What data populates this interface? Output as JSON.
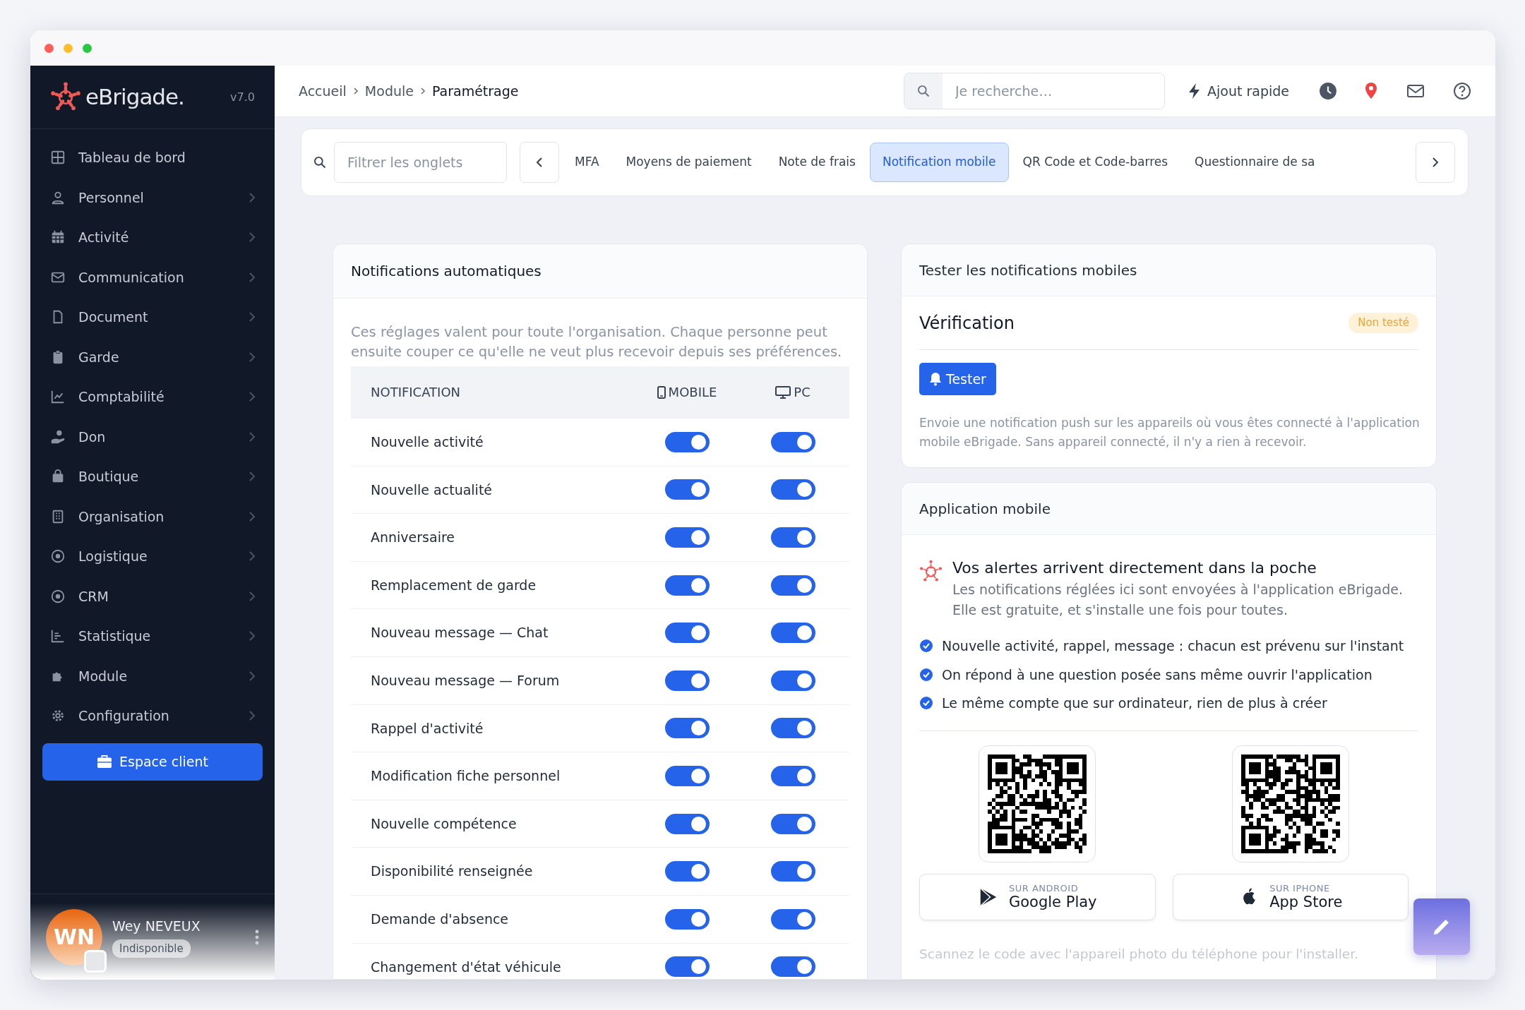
{
  "sidebar": {
    "logo": "eBrigade.",
    "version": "v7.0",
    "items": [
      {
        "label": "Tableau de bord",
        "expandable": false
      },
      {
        "label": "Personnel",
        "expandable": true
      },
      {
        "label": "Activité",
        "expandable": true
      },
      {
        "label": "Communication",
        "expandable": true
      },
      {
        "label": "Document",
        "expandable": true
      },
      {
        "label": "Garde",
        "expandable": true
      },
      {
        "label": "Comptabilité",
        "expandable": true
      },
      {
        "label": "Don",
        "expandable": true
      },
      {
        "label": "Boutique",
        "expandable": true
      },
      {
        "label": "Organisation",
        "expandable": true
      },
      {
        "label": "Logistique",
        "expandable": true
      },
      {
        "label": "CRM",
        "expandable": true
      },
      {
        "label": "Statistique",
        "expandable": true
      },
      {
        "label": "Module",
        "expandable": true
      },
      {
        "label": "Configuration",
        "expandable": true
      }
    ],
    "cta": "Espace client",
    "user": {
      "initials": "WN",
      "name": "Wey NEVEUX",
      "status": "Indisponible"
    }
  },
  "breadcrumb": [
    "Accueil",
    "Module",
    "Paramétrage"
  ],
  "search": {
    "placeholder": "Je recherche…"
  },
  "quick_add": "Ajout rapide",
  "tab_filter": {
    "placeholder": "Filtrer les onglets"
  },
  "tabs": [
    {
      "label": "MFA",
      "selected": false
    },
    {
      "label": "Moyens de paiement",
      "selected": false
    },
    {
      "label": "Note de frais",
      "selected": false
    },
    {
      "label": "Notification mobile",
      "selected": true
    },
    {
      "label": "QR Code et Code-barres",
      "selected": false
    },
    {
      "label": "Questionnaire de sa",
      "selected": false
    }
  ],
  "auto_notifications": {
    "title": "Notifications automatiques",
    "intro": "Ces réglages valent pour toute l'organisation. Chaque personne peut ensuite couper ce qu'elle ne veut plus recevoir depuis ses préférences.",
    "columns": [
      "NOTIFICATION",
      "MOBILE",
      "PC"
    ],
    "rows": [
      {
        "label": "Nouvelle activité",
        "mobile": true,
        "pc": true
      },
      {
        "label": "Nouvelle actualité",
        "mobile": true,
        "pc": true
      },
      {
        "label": "Anniversaire",
        "mobile": true,
        "pc": true
      },
      {
        "label": "Remplacement de garde",
        "mobile": true,
        "pc": true
      },
      {
        "label": "Nouveau message — Chat",
        "mobile": true,
        "pc": true
      },
      {
        "label": "Nouveau message — Forum",
        "mobile": true,
        "pc": true
      },
      {
        "label": "Rappel d'activité",
        "mobile": true,
        "pc": true
      },
      {
        "label": "Modification fiche personnel",
        "mobile": true,
        "pc": true
      },
      {
        "label": "Nouvelle compétence",
        "mobile": true,
        "pc": true
      },
      {
        "label": "Disponibilité renseignée",
        "mobile": true,
        "pc": true
      },
      {
        "label": "Demande d'absence",
        "mobile": true,
        "pc": true
      },
      {
        "label": "Changement d'état véhicule",
        "mobile": true,
        "pc": true
      }
    ]
  },
  "test_card": {
    "title": "Tester les notifications mobiles",
    "heading": "Vérification",
    "status": "Non testé",
    "button": "Tester",
    "description": "Envoie une notification push sur les appareils où vous êtes connecté à l'application mobile eBrigade. Sans appareil connecté, il n'y a rien à recevoir."
  },
  "app_card": {
    "title": "Application mobile",
    "headline": "Vos alertes arrivent directement dans la poche",
    "text": "Les notifications réglées ici sont envoyées à l'application eBrigade. Elle est gratuite, et s'installe une fois pour toutes.",
    "benefits": [
      "Nouvelle activité, rappel, message : chacun est prévenu sur l'instant",
      "On répond à une question posée sans même ouvrir l'application",
      "Le même compte que sur ordinateur, rien de plus à créer"
    ],
    "stores": [
      {
        "kind": "android",
        "caption": "SUR ANDROID",
        "name": "Google Play"
      },
      {
        "kind": "ios",
        "caption": "SUR IPHONE",
        "name": "App Store"
      }
    ],
    "footnote": "Scannez le code avec l'appareil photo du téléphone pour l'installer."
  }
}
